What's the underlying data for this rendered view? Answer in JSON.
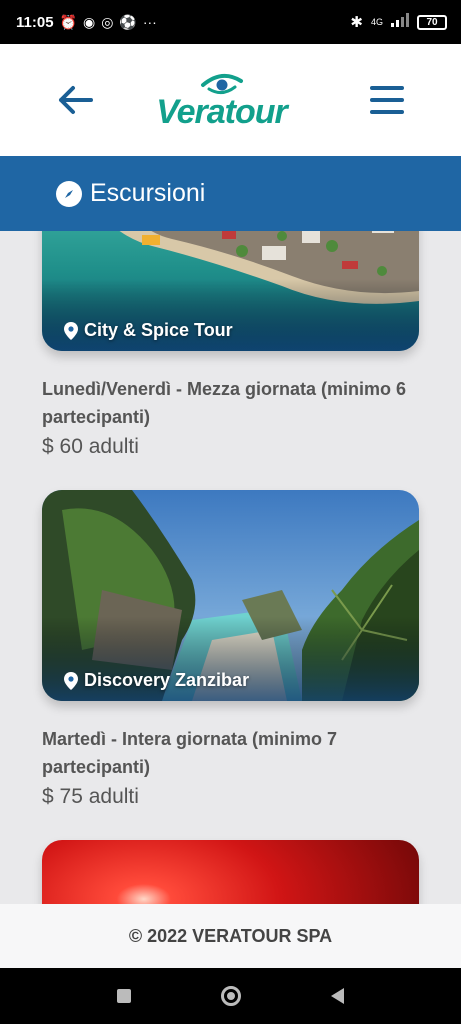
{
  "status_bar": {
    "time": "11:05",
    "network": "4G",
    "battery": "70"
  },
  "header": {
    "logo_text": "Veratour",
    "back_icon": "arrow-left-icon",
    "menu_icon": "hamburger-menu-icon"
  },
  "section": {
    "title": "Escursioni",
    "icon": "compass-icon"
  },
  "excursions": [
    {
      "name": "City & Spice Tour",
      "schedule": "Lunedì/Venerdì - Mezza giornata (minimo 6 partecipanti)",
      "price": "$ 60 adulti"
    },
    {
      "name": "Discovery Zanzibar",
      "schedule": "Martedì - Intera giornata (minimo 7 partecipanti)",
      "price": "$ 75 adulti"
    }
  ],
  "footer": {
    "copyright": "© 2022 VERATOUR SPA"
  },
  "colors": {
    "brand_blue": "#1f66a4",
    "brand_teal": "#12a08c",
    "nav_blue": "#1a5f95"
  }
}
